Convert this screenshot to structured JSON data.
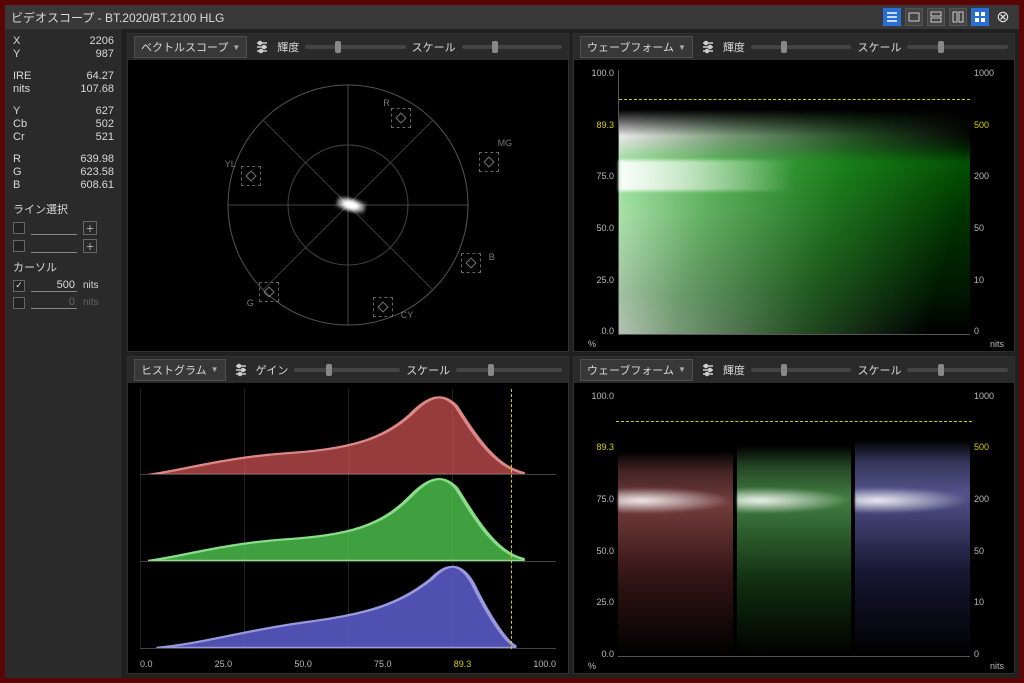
{
  "title": "ビデオスコープ - BT.2020/BT.2100 HLG",
  "sidebar": {
    "stats": {
      "X": "2206",
      "Y": "987",
      "IRE": "64.27",
      "nits": "107.68",
      "Yc": "627",
      "Cb": "502",
      "Cr": "521",
      "R": "639.98",
      "G": "623.58",
      "B": "608.61"
    },
    "line_select_label": "ライン選択",
    "cursor_label": "カーソル",
    "cursor1_value": "500",
    "cursor2_value": "0",
    "unit": "nits"
  },
  "panels": {
    "vectorscope": {
      "dropdown": "ベクトルスコープ",
      "slider1": "輝度",
      "slider2": "スケール",
      "targets": [
        "R",
        "MG",
        "B",
        "CY",
        "G",
        "YL"
      ]
    },
    "waveform_luma": {
      "dropdown": "ウェーブフォーム",
      "slider1": "輝度",
      "slider2": "スケール",
      "left_ticks": [
        "100.0",
        "89.3",
        "75.0",
        "50.0",
        "25.0",
        "0.0"
      ],
      "right_ticks": [
        "1000",
        "500",
        "200",
        "50",
        "10",
        "0"
      ],
      "left_unit": "%",
      "right_unit": "nits"
    },
    "histogram": {
      "dropdown": "ヒストグラム",
      "slider1": "ゲイン",
      "slider2": "スケール",
      "x_ticks": [
        "0.0",
        "25.0",
        "50.0",
        "75.0",
        "89.3",
        "100.0"
      ]
    },
    "waveform_rgb": {
      "dropdown": "ウェーブフォーム",
      "slider1": "輝度",
      "slider2": "スケール",
      "left_ticks": [
        "100.0",
        "89.3",
        "75.0",
        "50.0",
        "25.0",
        "0.0"
      ],
      "right_ticks": [
        "1000",
        "500",
        "200",
        "50",
        "10",
        "0"
      ],
      "left_unit": "%",
      "right_unit": "nits"
    }
  },
  "chart_data": [
    {
      "type": "scatter",
      "name": "vectorscope",
      "note": "Single bright cluster near center, slightly right-of-center on I axis",
      "targets": [
        "R",
        "MG",
        "B",
        "CY",
        "G",
        "YL"
      ]
    },
    {
      "type": "line",
      "name": "waveform-luma",
      "ylabel_left": "%",
      "ylabel_right": "nits",
      "ylim_left": [
        0,
        100
      ],
      "ylim_right": [
        0,
        1000
      ],
      "marker_nits": 500,
      "marker_pct": 89.3,
      "note": "Luma trace roughly 55-75% band, rising slightly left-to-right; bright white highlights on left"
    },
    {
      "type": "area",
      "name": "histogram-rgb",
      "x": [
        0,
        25,
        50,
        75,
        89.3,
        100
      ],
      "xlim": [
        0,
        100
      ],
      "series": [
        {
          "name": "R",
          "peak_x": 72,
          "spread": [
            10,
            90
          ]
        },
        {
          "name": "G",
          "peak_x": 72,
          "spread": [
            10,
            90
          ]
        },
        {
          "name": "B",
          "peak_x": 74,
          "spread": [
            15,
            88
          ]
        }
      ],
      "marker_pct": 89.3
    },
    {
      "type": "line",
      "name": "waveform-rgb-parade",
      "ylabel_left": "%",
      "ylabel_right": "nits",
      "ylim_left": [
        0,
        100
      ],
      "ylim_right": [
        0,
        1000
      ],
      "marker_nits": 500,
      "marker_pct": 89.3,
      "channels": [
        "R",
        "G",
        "B"
      ],
      "note": "Each channel similar distribution ~45-75%, B slightly higher peak"
    }
  ]
}
